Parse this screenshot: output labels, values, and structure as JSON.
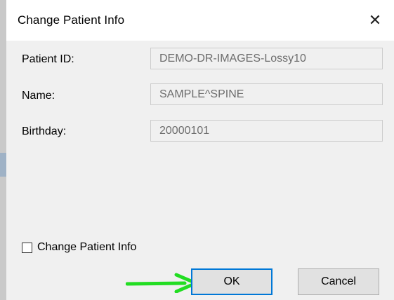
{
  "dialog": {
    "title": "Change Patient Info",
    "close_icon": "close-icon"
  },
  "fields": [
    {
      "label": "Patient ID:",
      "value": "DEMO-DR-IMAGES-Lossy10"
    },
    {
      "label": "Name:",
      "value": "SAMPLE^SPINE"
    },
    {
      "label": "Birthday:",
      "value": "20000101"
    }
  ],
  "checkbox": {
    "label": "Change Patient Info",
    "checked": false
  },
  "buttons": {
    "ok": "OK",
    "cancel": "Cancel"
  },
  "colors": {
    "annotation_arrow": "#22dd22",
    "ok_focus_border": "#0078d7"
  }
}
